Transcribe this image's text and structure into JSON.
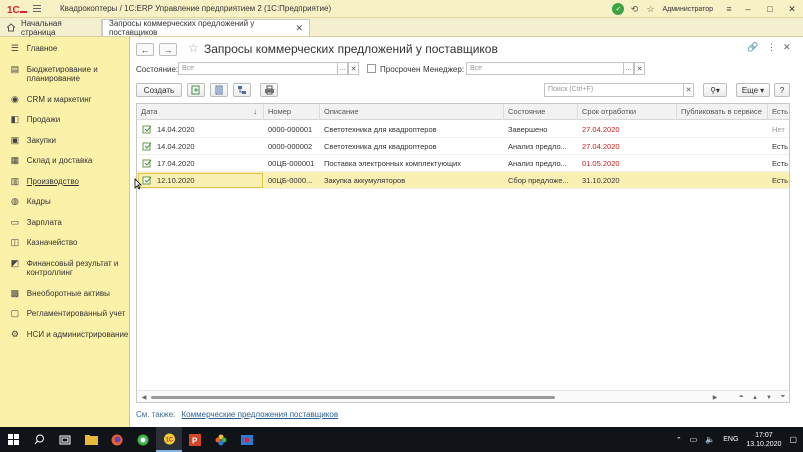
{
  "titlebar": {
    "title": "Квадрокоптеры / 1С:ERP Управление предприятием 2  (1С:Предприятие)",
    "user": "Администратор"
  },
  "tabs": {
    "home": "Начальная страница",
    "active": "Запросы коммерческих предложений у поставщиков"
  },
  "sidebar": {
    "items": [
      {
        "label": "Главное",
        "icon": "menu-icon"
      },
      {
        "label": "Бюджетирование и планирование",
        "icon": "budget-icon"
      },
      {
        "label": "CRM и маркетинг",
        "icon": "crm-icon"
      },
      {
        "label": "Продажи",
        "icon": "sales-icon"
      },
      {
        "label": "Закупки",
        "icon": "purchase-icon"
      },
      {
        "label": "Склад и доставка",
        "icon": "warehouse-icon"
      },
      {
        "label": "Производство",
        "icon": "production-icon"
      },
      {
        "label": "Кадры",
        "icon": "hr-icon"
      },
      {
        "label": "Зарплата",
        "icon": "salary-icon"
      },
      {
        "label": "Казначейство",
        "icon": "treasury-icon"
      },
      {
        "label": "Финансовый результат и контроллинг",
        "icon": "finance-icon"
      },
      {
        "label": "Внеоборотные активы",
        "icon": "assets-icon"
      },
      {
        "label": "Регламентированный учет",
        "icon": "accounting-icon"
      },
      {
        "label": "НСИ и администрирование",
        "icon": "admin-icon"
      }
    ]
  },
  "page": {
    "title": "Запросы коммерческих предложений у поставщиков"
  },
  "filters": {
    "state_label": "Состояние:",
    "state_placeholder": "Все",
    "overdue_label": "Просрочен",
    "manager_label": "Менеджер:",
    "manager_placeholder": "Все"
  },
  "toolbar": {
    "create": "Создать",
    "search_placeholder": "Поиск (Ctrl+F)",
    "more": "Еще",
    "help": "?"
  },
  "table": {
    "columns": [
      "Дата",
      "Номер",
      "Описание",
      "Состояние",
      "Срок отработки",
      "Публиковать в сервисе",
      "Есть"
    ],
    "rows": [
      {
        "date": "14.04.2020",
        "number": "0000-000001",
        "description": "Светотехника для квадроптеров",
        "state": "Завершено",
        "deadline": "27.04.2020",
        "publish": "Нет"
      },
      {
        "date": "14.04.2020",
        "number": "0000-000002",
        "description": "Светотехника для квадроптеров",
        "state": "Анализ предло...",
        "deadline": "27.04.2020",
        "publish": "Есть"
      },
      {
        "date": "17.04.2020",
        "number": "00ЦБ-000001",
        "description": "Поставка электронных комплектующих",
        "state": "Анализ предло...",
        "deadline": "01.05.2020",
        "publish": "Есть"
      },
      {
        "date": "12.10.2020",
        "number": "00ЦБ-0000...",
        "description": "Закупка аккумуляторов",
        "state": "Сбор предложе...",
        "deadline": "31.10.2020",
        "publish": "Есть"
      }
    ]
  },
  "footer": {
    "see_also": "См. также:",
    "link": "Коммерческие предложения поставщиков"
  },
  "taskbar": {
    "lang": "ENG",
    "time": "17:07",
    "date": "13.10.2020"
  },
  "colors": {
    "sidebar_bg": "#fbf1a8",
    "selected_row": "#fbf0b4",
    "overdue_red": "#c8201d",
    "link": "#2a5f8f"
  }
}
